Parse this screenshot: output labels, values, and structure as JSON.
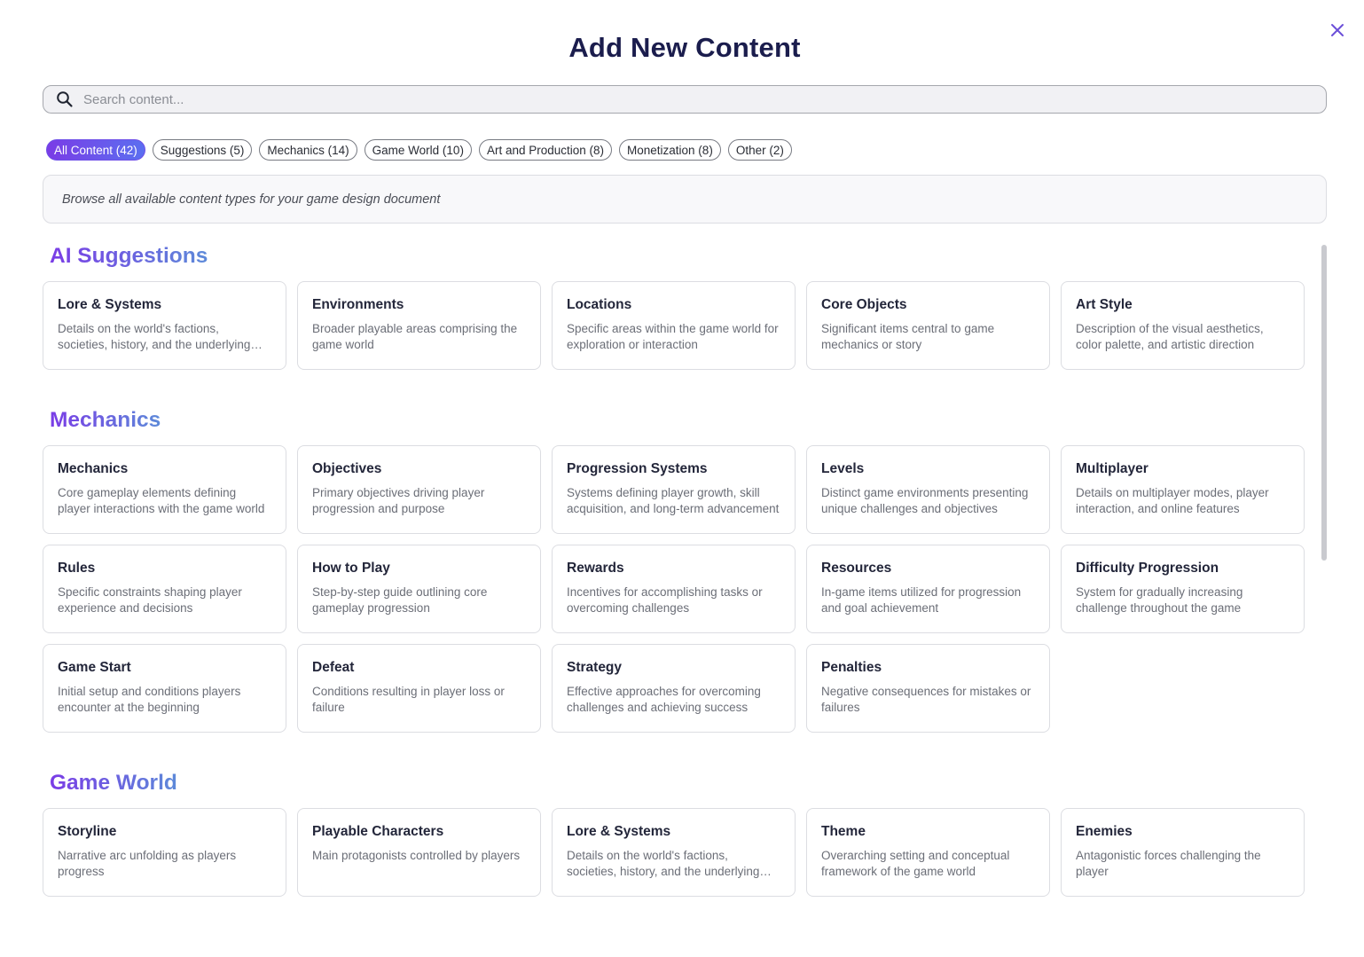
{
  "dialog": {
    "title": "Add New Content",
    "search_placeholder": "Search content...",
    "description": "Browse all available content types for your game design document"
  },
  "filters": [
    {
      "label": "All Content (42)",
      "active": true
    },
    {
      "label": "Suggestions (5)",
      "active": false
    },
    {
      "label": "Mechanics (14)",
      "active": false
    },
    {
      "label": "Game World (10)",
      "active": false
    },
    {
      "label": "Art and Production (8)",
      "active": false
    },
    {
      "label": "Monetization (8)",
      "active": false
    },
    {
      "label": "Other (2)",
      "active": false
    }
  ],
  "sections": [
    {
      "title": "AI Suggestions",
      "cards": [
        {
          "title": "Lore & Systems",
          "desc": "Details on the world's factions, societies, history, and the underlying systems that govern them"
        },
        {
          "title": "Environments",
          "desc": "Broader playable areas comprising the game world"
        },
        {
          "title": "Locations",
          "desc": "Specific areas within the game world for exploration or interaction"
        },
        {
          "title": "Core Objects",
          "desc": "Significant items central to game mechanics or story"
        },
        {
          "title": "Art Style",
          "desc": "Description of the visual aesthetics, color palette, and artistic direction"
        }
      ]
    },
    {
      "title": "Mechanics",
      "cards": [
        {
          "title": "Mechanics",
          "desc": "Core gameplay elements defining player interactions with the game world"
        },
        {
          "title": "Objectives",
          "desc": "Primary objectives driving player progression and purpose"
        },
        {
          "title": "Progression Systems",
          "desc": "Systems defining player growth, skill acquisition, and long-term advancement"
        },
        {
          "title": "Levels",
          "desc": "Distinct game environments presenting unique challenges and objectives"
        },
        {
          "title": "Multiplayer",
          "desc": "Details on multiplayer modes, player interaction, and online features"
        },
        {
          "title": "Rules",
          "desc": "Specific constraints shaping player experience and decisions"
        },
        {
          "title": "How to Play",
          "desc": "Step-by-step guide outlining core gameplay progression"
        },
        {
          "title": "Rewards",
          "desc": "Incentives for accomplishing tasks or overcoming challenges"
        },
        {
          "title": "Resources",
          "desc": "In-game items utilized for progression and goal achievement"
        },
        {
          "title": "Difficulty Progression",
          "desc": "System for gradually increasing challenge throughout the game"
        },
        {
          "title": "Game Start",
          "desc": "Initial setup and conditions players encounter at the beginning"
        },
        {
          "title": "Defeat",
          "desc": "Conditions resulting in player loss or failure"
        },
        {
          "title": "Strategy",
          "desc": "Effective approaches for overcoming challenges and achieving success"
        },
        {
          "title": "Penalties",
          "desc": "Negative consequences for mistakes or failures"
        }
      ]
    },
    {
      "title": "Game World",
      "cards": [
        {
          "title": "Storyline",
          "desc": "Narrative arc unfolding as players progress"
        },
        {
          "title": "Playable Characters",
          "desc": "Main protagonists controlled by players"
        },
        {
          "title": "Lore & Systems",
          "desc": "Details on the world's factions, societies, history, and the underlying systems that govern them"
        },
        {
          "title": "Theme",
          "desc": "Overarching setting and conceptual framework of the game world"
        },
        {
          "title": "Enemies",
          "desc": "Antagonistic forces challenging the player"
        }
      ]
    }
  ],
  "colors": {
    "title": "#1b1d4d",
    "accent_start": "#7a3ce6",
    "accent_end": "#5d8ad9",
    "close_icon": "#6b4fd8"
  }
}
